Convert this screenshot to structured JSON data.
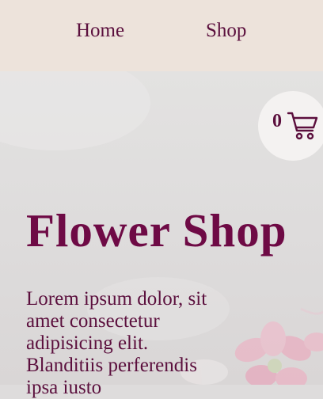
{
  "nav": {
    "home_label": "Home",
    "shop_label": "Shop"
  },
  "cart": {
    "count": "0",
    "icon": "shopping-cart-icon"
  },
  "hero": {
    "title": "Flower Shop",
    "description": "Lorem ipsum dolor, sit amet consectetur adipisicing elit. Blanditiis perferendis ipsa iusto"
  },
  "colors": {
    "nav_background": "#ede3db",
    "accent": "#6e0a45",
    "text": "#5b0f3d",
    "cart_bubble": "#f4f2f1"
  }
}
